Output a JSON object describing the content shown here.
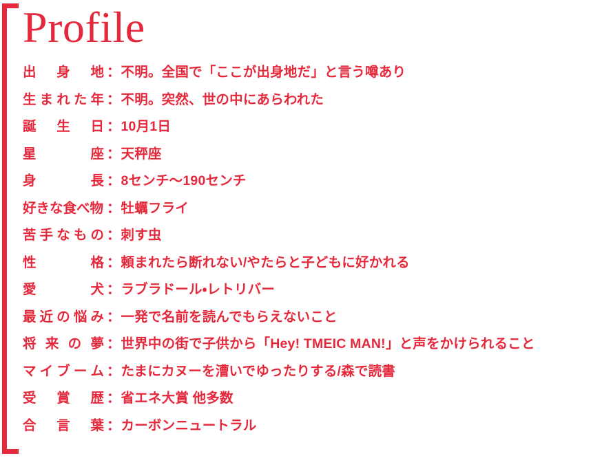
{
  "theme": {
    "accent_color": "#e5293c",
    "background_color": "#ffffff"
  },
  "header": {
    "title": "Profile"
  },
  "separator": "：",
  "profile": {
    "rows": [
      {
        "label": "出身地",
        "value": "不明。全国で「ここが出身地だ」と言う噂あり"
      },
      {
        "label": "生まれた年",
        "value": "不明。突然、世の中にあらわれた"
      },
      {
        "label": "誕生日",
        "value": "10月1日"
      },
      {
        "label": "星座",
        "value": "天秤座"
      },
      {
        "label": "身長",
        "value": "8センチ〜190センチ"
      },
      {
        "label": "好きな食べ物",
        "value": "牡蠣フライ"
      },
      {
        "label": "苦手なもの",
        "value": "刺す虫"
      },
      {
        "label": "性格",
        "value": "頼まれたら断れない/やたらと子どもに好かれる"
      },
      {
        "label": "愛犬",
        "value": "ラブラドール・レトリバー"
      },
      {
        "label": "最近の悩み",
        "value": "一発で名前を読んでもらえないこと"
      },
      {
        "label": "将来の夢",
        "value": "世界中の街で子供から「Hey! TMEIC MAN!」と声をかけられること"
      },
      {
        "label": "マイブーム",
        "value": "たまにカヌーを漕いでゆったりする/森で読書"
      },
      {
        "label": "受賞歴",
        "value": "省エネ大賞 他多数"
      },
      {
        "label": "合言葉",
        "value": "カーボンニュートラル"
      }
    ]
  }
}
